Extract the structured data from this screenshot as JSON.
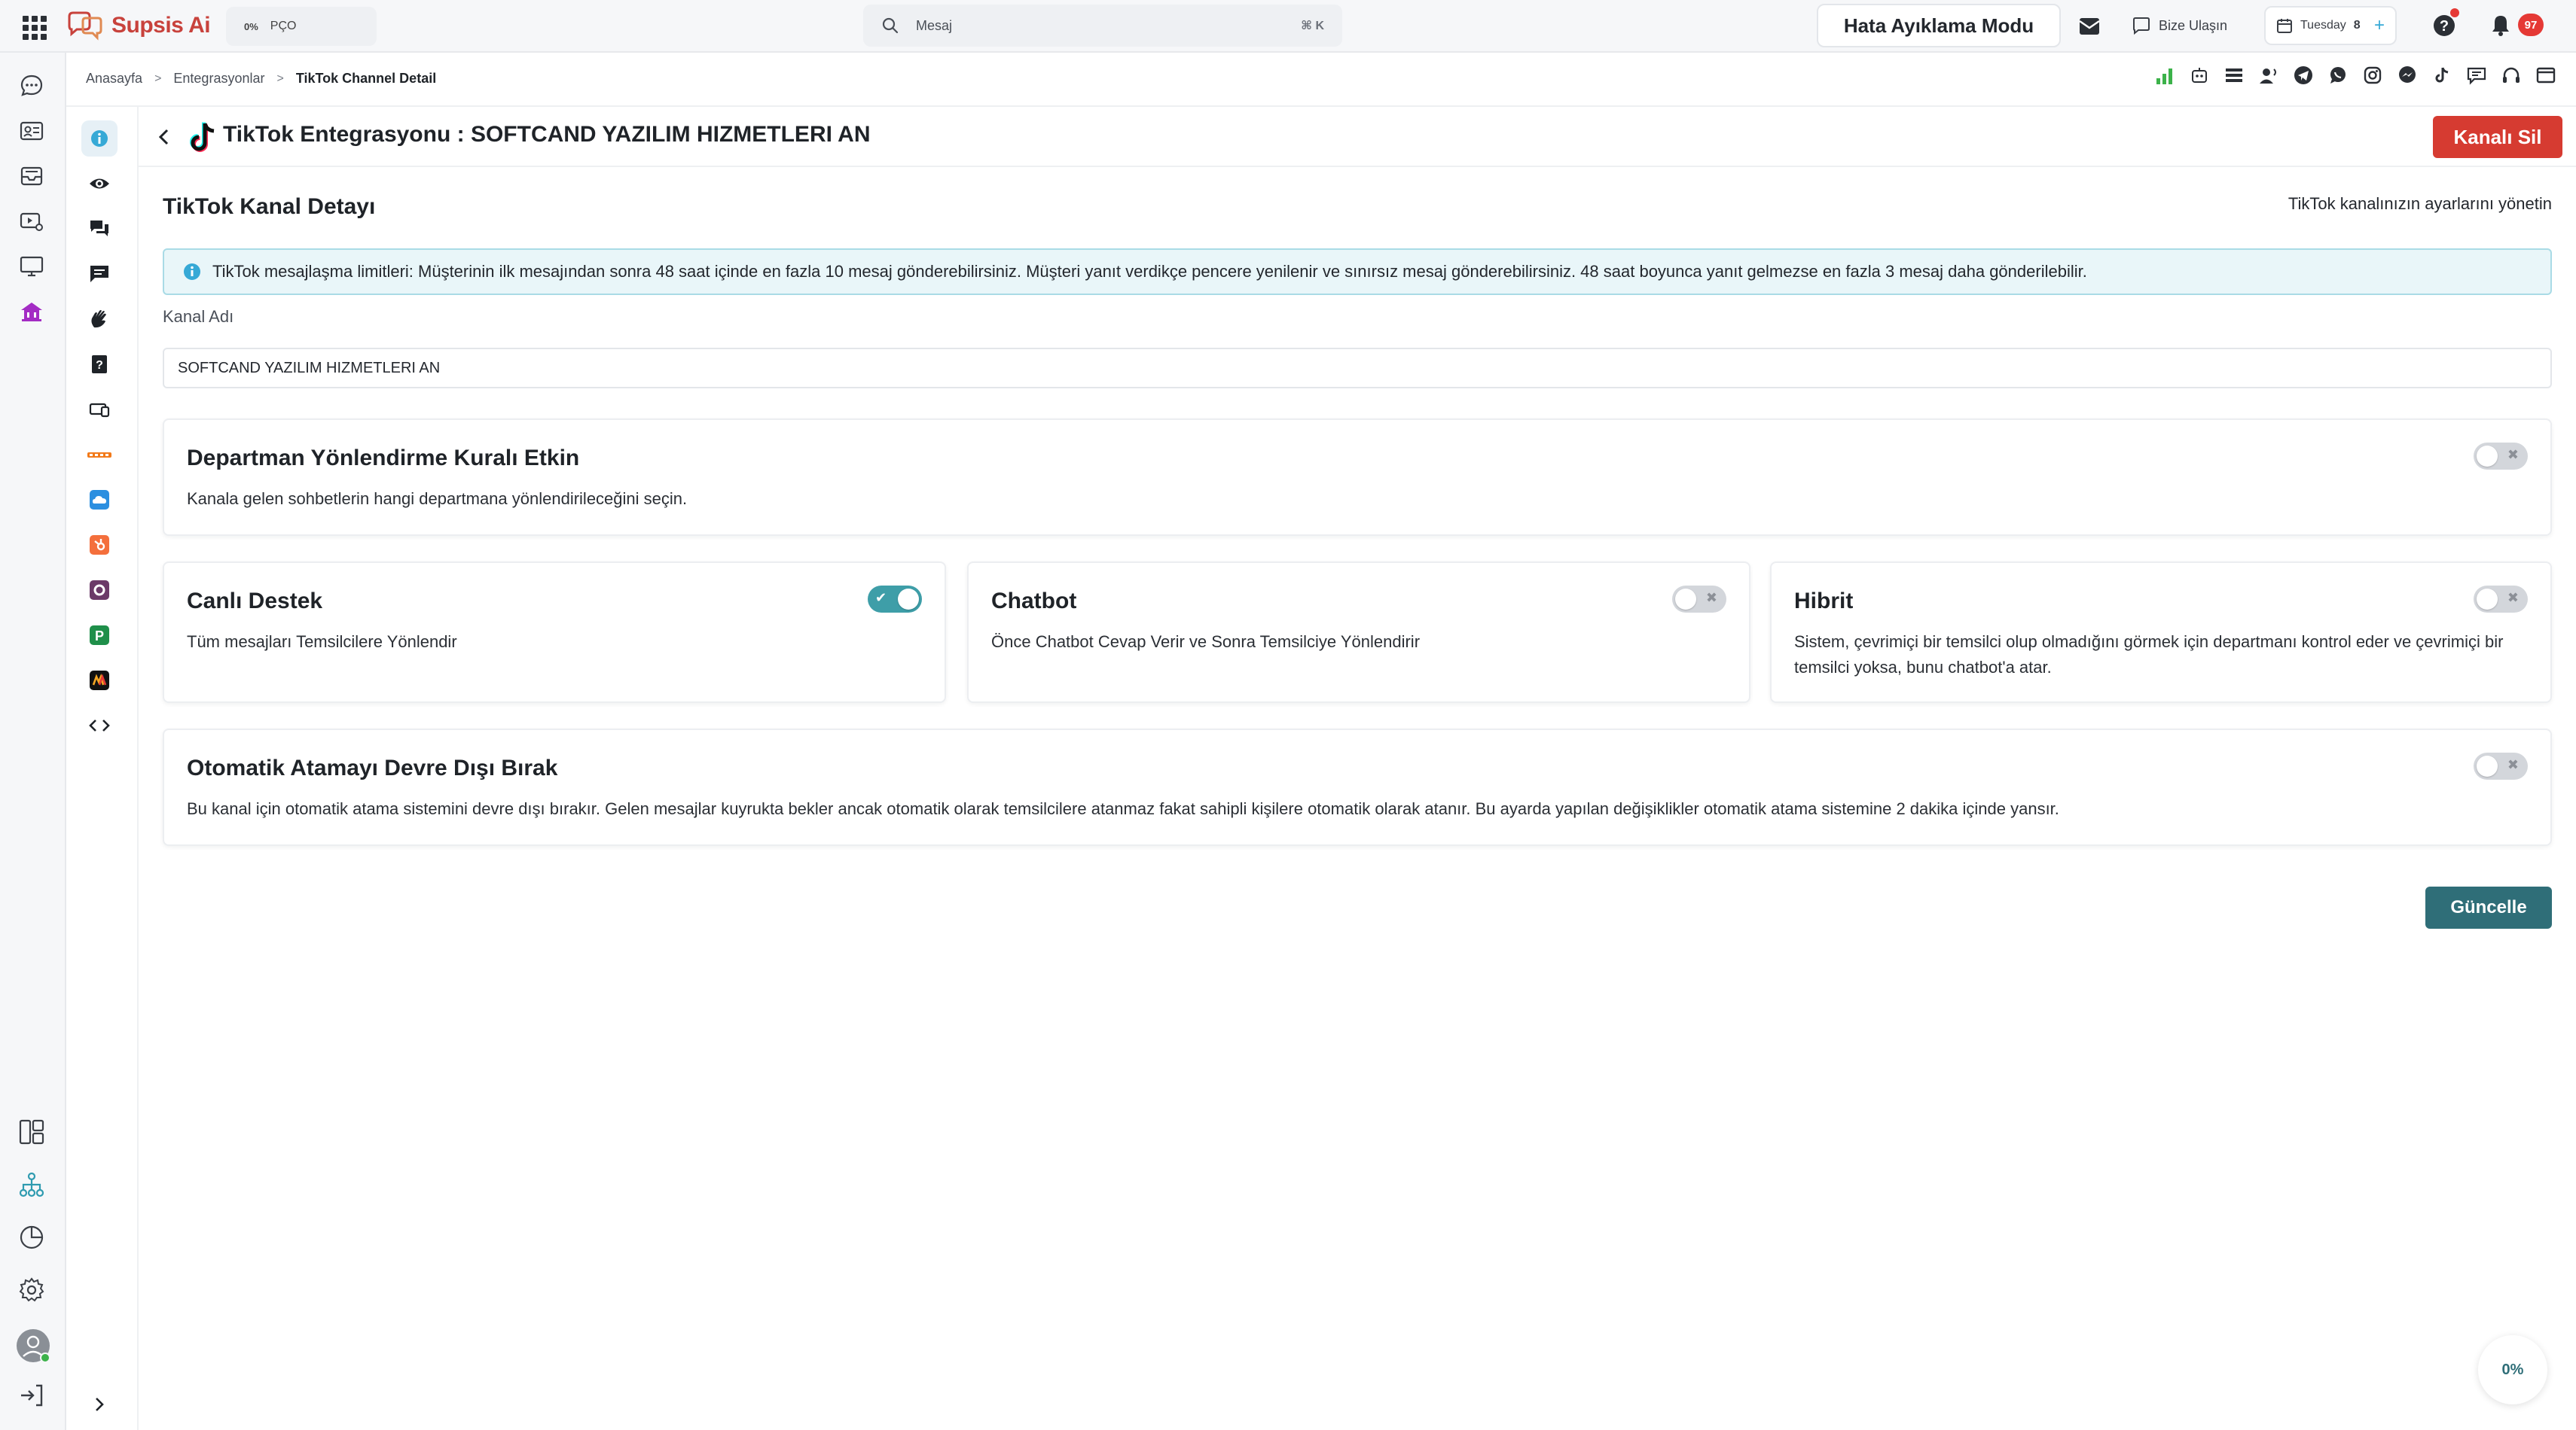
{
  "app": {
    "brand": "Supsis Ai"
  },
  "topbar": {
    "pco_percent": "0%",
    "pco_label": "PÇO",
    "search_placeholder": "Mesaj",
    "search_shortcut": "⌘ K",
    "debug_label": "Hata Ayıklama Modu",
    "contact_label": "Bize Ulaşın",
    "date_day": "Tuesday",
    "date_num": "8",
    "date_plus": "+",
    "notification_count": "97"
  },
  "breadcrumb": [
    "Anasayfa",
    "Entegrasyonlar",
    "TikTok Channel Detail"
  ],
  "page": {
    "title": "TikTok Entegrasyonu : SOFTCAND YAZILIM HIZMETLERI AN",
    "delete_label": "Kanalı Sil",
    "section_title": "TikTok Kanal Detayı",
    "section_subtitle": "TikTok kanalınızın ayarlarını yönetin",
    "alert_text": "TikTok mesajlaşma limitleri: Müşterinin ilk mesajından sonra 48 saat içinde en fazla 10 mesaj gönderebilirsiniz. Müşteri yanıt verdikçe pencere yenilenir ve sınırsız mesaj gönderebilirsiniz. 48 saat boyunca yanıt gelmezse en fazla 3 mesaj daha gönderilebilir.",
    "channel_name_label": "Kanal Adı",
    "channel_name_value": "SOFTCAND YAZILIM HIZMETLERI AN",
    "update_label": "Güncelle"
  },
  "cards": {
    "department": {
      "title": "Departman Yönlendirme Kuralı Etkin",
      "desc": "Kanala gelen sohbetlerin hangi departmana yönlendirileceğini seçin.",
      "enabled": false
    },
    "live": {
      "title": "Canlı Destek",
      "desc": "Tüm mesajları Temsilcilere Yönlendir",
      "enabled": true
    },
    "chatbot": {
      "title": "Chatbot",
      "desc": "Önce Chatbot Cevap Verir ve Sonra Temsilciye Yönlendirir",
      "enabled": false
    },
    "hybrid": {
      "title": "Hibrit",
      "desc": "Sistem, çevrimiçi bir temsilci olup olmadığını görmek için departmanı kontrol eder ve çevrimiçi bir temsilci yoksa, bunu chatbot'a atar.",
      "enabled": false
    },
    "auto_assign": {
      "title": "Otomatik Atamayı Devre Dışı Bırak",
      "desc": "Bu kanal için otomatik atama sistemini devre dışı bırakır. Gelen mesajlar kuyrukta bekler ancak otomatik olarak temsilcilere atanmaz fakat sahipli kişilere otomatik olarak atanır. Bu ayarda yapılan değişiklikler otomatik atama sistemine 2 dakika içinde yansır.",
      "enabled": false
    }
  },
  "toggle_marks": {
    "on": "✔",
    "off": "✖"
  },
  "progress_badge": "0%",
  "colors": {
    "accent": "#2f6e78",
    "danger": "#d63b31",
    "toggle_on": "#3e9ea8",
    "brand": "#c8423c"
  }
}
